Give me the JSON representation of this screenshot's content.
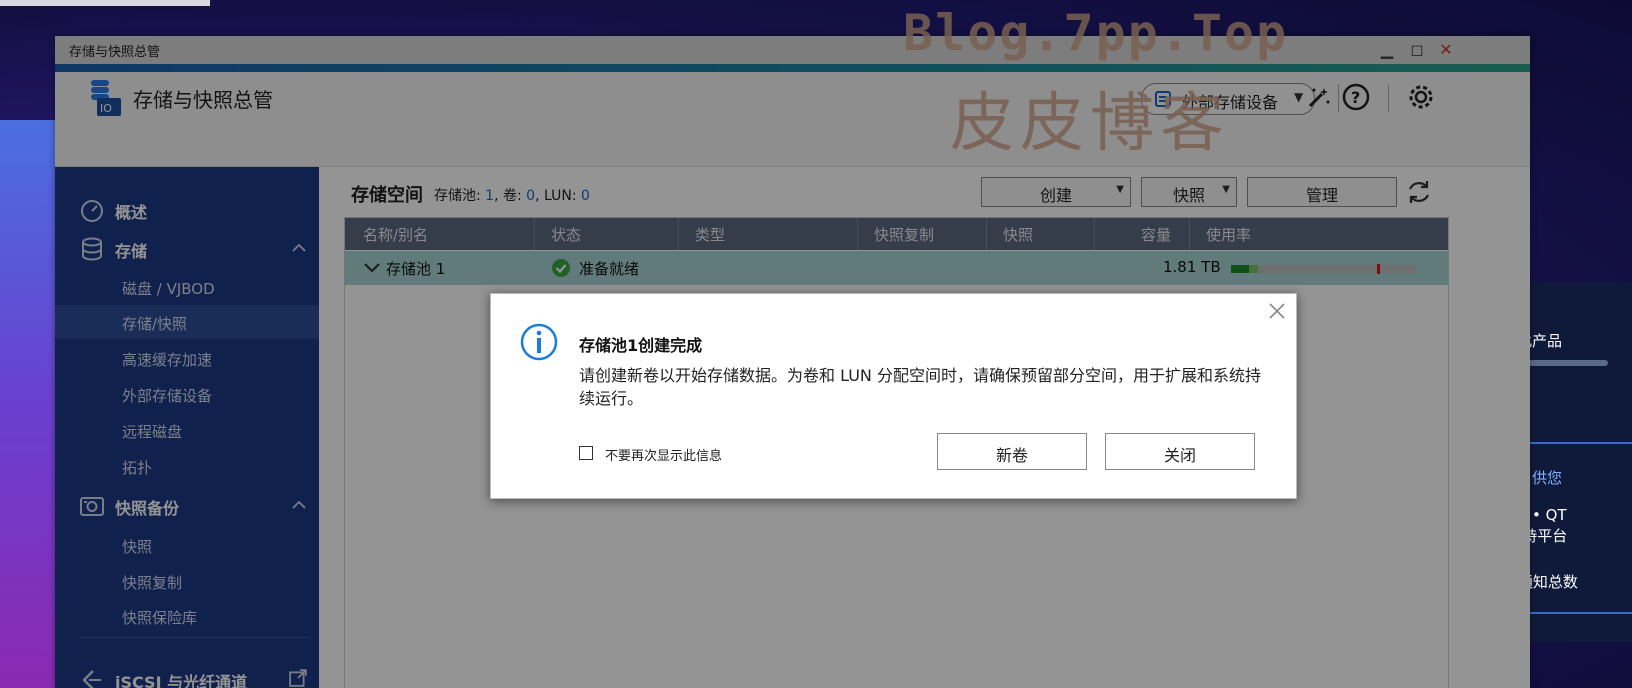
{
  "window": {
    "title": "存储与快照总管"
  },
  "header": {
    "app_title": "存储与快照总管",
    "external_storage_button": "外部存储设备"
  },
  "sidebar": {
    "items": [
      {
        "label": "概述",
        "icon": "dashboard-icon"
      },
      {
        "label": "存储",
        "icon": "database-icon",
        "expanded": true
      },
      {
        "label": "磁盘 / VJBOD"
      },
      {
        "label": "存储/快照",
        "active": true
      },
      {
        "label": "高速缓存加速"
      },
      {
        "label": "外部存储设备"
      },
      {
        "label": "远程磁盘"
      },
      {
        "label": "拓扑"
      },
      {
        "label": "快照备份",
        "icon": "camera-icon",
        "expanded": true
      },
      {
        "label": "快照"
      },
      {
        "label": "快照复制"
      },
      {
        "label": "快照保险库"
      },
      {
        "label": "iSCSI 与光纤通道",
        "icon": "iscsi-icon"
      }
    ]
  },
  "main": {
    "title": "存储空间",
    "summary": {
      "pool_label": "存储池:",
      "pool_count": "1",
      "volume_label": ", 卷:",
      "volume_count": "0",
      "lun_label": ", LUN:",
      "lun_count": "0"
    },
    "toolbar": {
      "create": "创建",
      "snapshot": "快照",
      "manage": "管理"
    },
    "table": {
      "columns": [
        "名称/别名",
        "状态",
        "类型",
        "快照复制",
        "快照",
        "容量",
        "使用率"
      ],
      "rows": [
        {
          "name": "存储池 1",
          "status": "准备就绪",
          "type": "",
          "replication": "",
          "snapshot": "",
          "capacity": "1.81 TB"
        }
      ]
    }
  },
  "dialog": {
    "title": "存储池1创建完成",
    "message": "请创建新卷以开始存储数据。为卷和 LUN 分配空间时，请确保预留部分空间，用于扩展和系统持续运行。",
    "checkbox_label": "不要再次显示此信息",
    "checkbox_checked": false,
    "new_volume_button": "新卷",
    "close_button": "关闭"
  },
  "watermark": {
    "line1": "Blog.7pp.Top",
    "line2": "皮皮博客"
  },
  "background": {
    "text1": "始使用此产品",
    "text2": "的资源，供您",
    "text3": "下各项：• QT",
    "text4": "desk支持平台",
    "text5": "(通知总数"
  },
  "colors": {
    "sidebar": "#1c3a86",
    "sidebar_active": "#2e4e98",
    "table_header": "#5b6a7e",
    "row_selected": "#a7d4d8",
    "accent_link": "#1a64c4",
    "status_ok": "#3aa845"
  }
}
